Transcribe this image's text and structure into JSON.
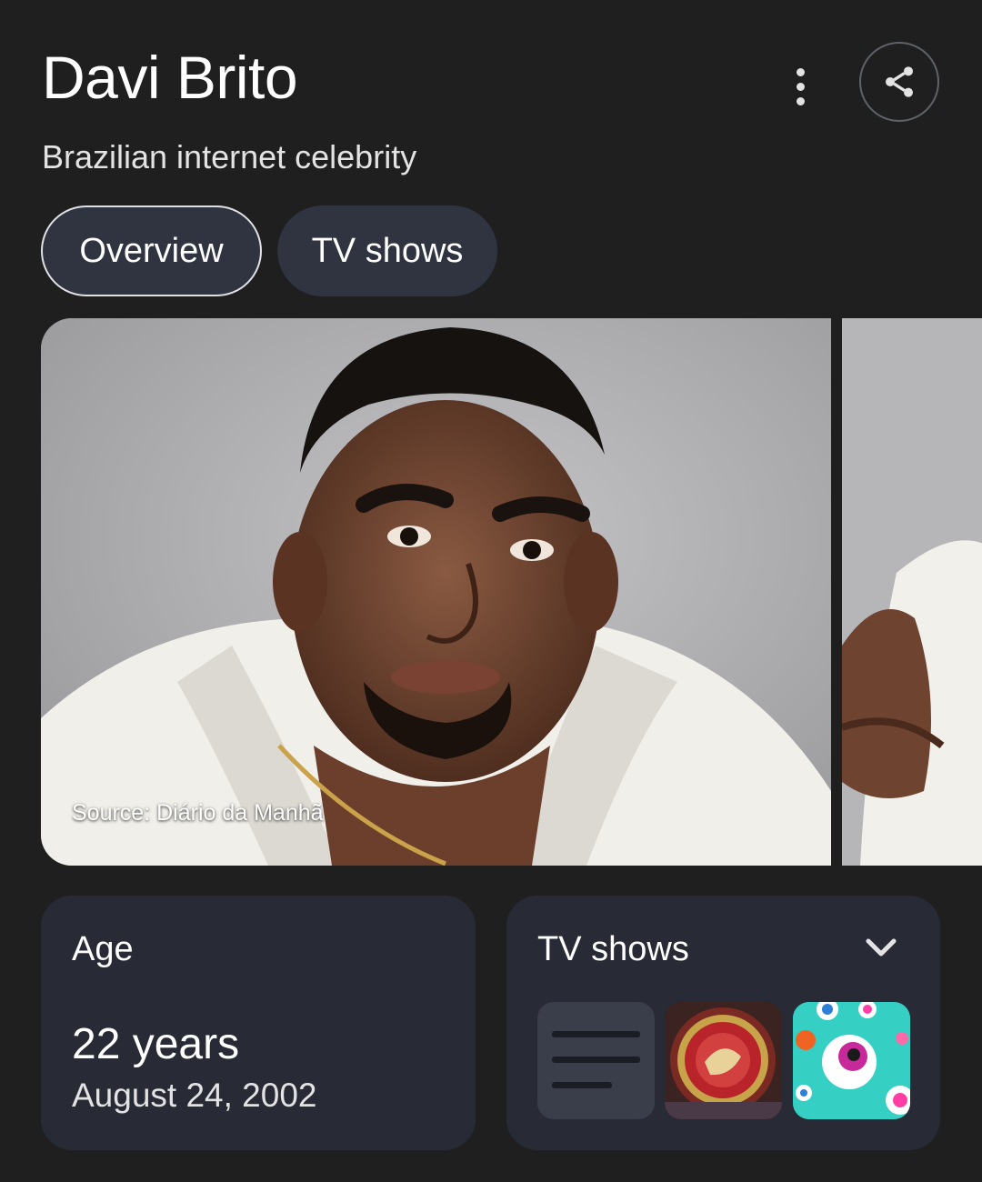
{
  "header": {
    "title": "Davi Brito",
    "subtitle": "Brazilian internet celebrity"
  },
  "actions": {
    "more_icon": "more-vert-icon",
    "share_icon": "share-icon"
  },
  "tabs": [
    {
      "label": "Overview",
      "selected": true
    },
    {
      "label": "TV shows",
      "selected": false
    }
  ],
  "gallery": {
    "source_caption": "Source: Diário da Manhã"
  },
  "age_card": {
    "label": "Age",
    "value": "22 years",
    "birth_date": "August 24, 2002"
  },
  "tv_card": {
    "label": "TV shows",
    "expand_icon": "chevron-down-icon"
  },
  "colors": {
    "background": "#1f1f1f",
    "card": "#282b35",
    "chip": "#303441",
    "chip_border": "#dfe1e5",
    "text": "#ffffff"
  }
}
